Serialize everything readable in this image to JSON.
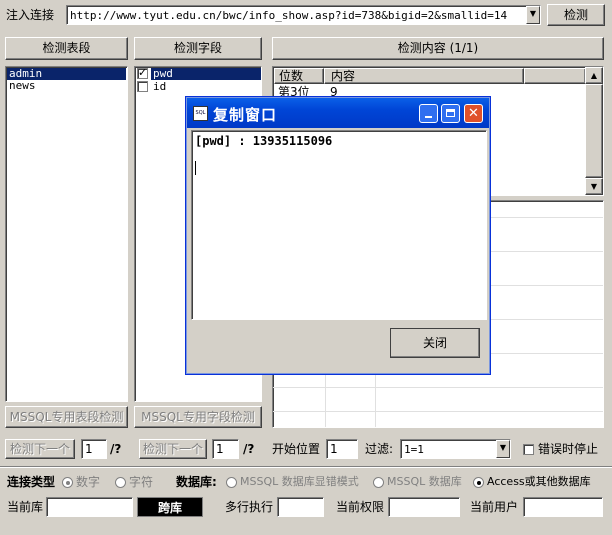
{
  "topbar": {
    "inject_label": "注入连接",
    "url": "http://www.tyut.edu.cn/bwc/info_show.asp?id=738&bigid=2&smallid=14",
    "detect_button": "检测"
  },
  "panels": {
    "tables_header": "检测表段",
    "fields_header": "检测字段",
    "content_header": "检测内容 (1/1)"
  },
  "tables_list": [
    "admin",
    "news"
  ],
  "fields_list": [
    {
      "name": "pwd",
      "checked": true
    },
    {
      "name": "id",
      "checked": false
    }
  ],
  "content_table": {
    "columns": [
      "位数",
      "内容"
    ],
    "rows": [
      [
        "第3位",
        "9"
      ]
    ]
  },
  "mssql_buttons": {
    "tables": "MSSQL专用表段检测",
    "fields": "MSSQL专用字段检测"
  },
  "nav_row": {
    "next1": "检测下一个",
    "page1_value": "1",
    "page1_suffix": "/?",
    "next2": "检测下一个",
    "page2_value": "1",
    "page2_suffix": "/?",
    "start_pos_label": "开始位置",
    "start_pos_value": "1",
    "filter_label": "过滤:",
    "filter_value": "1=1",
    "stop_on_error_label": "错误时停止"
  },
  "conn_row": {
    "conn_type_label": "连接类型",
    "numeric": "数字",
    "char": "字符",
    "db_label": "数据库:",
    "mssql_err": "MSSQL 数据库显错模式",
    "mssql_db": "MSSQL 数据库",
    "access": "Access或其他数据库"
  },
  "bottom_row": {
    "current_db_label": "当前库",
    "cross_db_button": "跨库",
    "multiline_label": "多行执行",
    "current_perm_label": "当前权限",
    "current_user_label": "当前用户"
  },
  "dialog": {
    "title": "复制窗口",
    "content": "[pwd] : 13935115096",
    "close_button": "关闭"
  },
  "colors": {
    "selection": "#0a246a",
    "titlebar": "#0045d6",
    "close_button": "#e0512a"
  }
}
